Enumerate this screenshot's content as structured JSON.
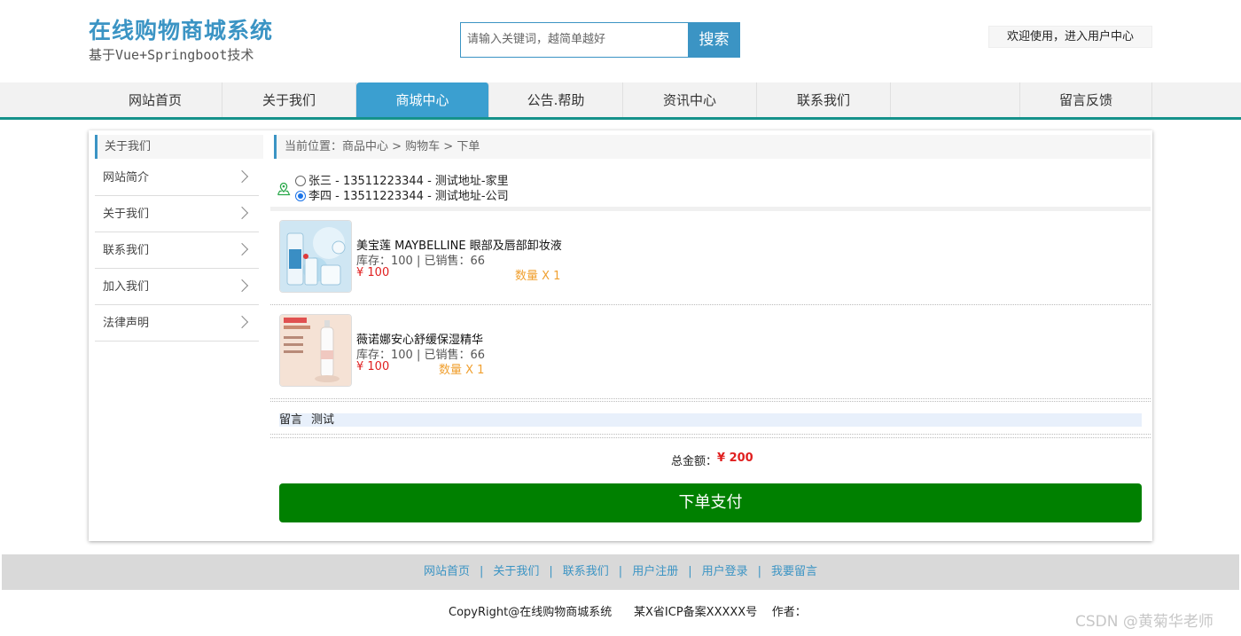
{
  "header": {
    "title": "在线购物商城系统",
    "subtitle": "基于Vue+Springboot技术",
    "search_placeholder": "请输入关键词，越简单越好",
    "search_button": "搜索",
    "welcome": "欢迎使用，进入用户中心"
  },
  "nav": {
    "items": [
      {
        "label": "网站首页"
      },
      {
        "label": "关于我们"
      },
      {
        "label": "商城中心"
      },
      {
        "label": "公告.帮助"
      },
      {
        "label": "资讯中心"
      },
      {
        "label": "联系我们"
      },
      {
        "label": "留言反馈"
      }
    ],
    "active_index": 2
  },
  "sidebar": {
    "heading": "关于我们",
    "items": [
      {
        "label": "网站简介"
      },
      {
        "label": "关于我们"
      },
      {
        "label": "联系我们"
      },
      {
        "label": "加入我们"
      },
      {
        "label": "法律声明"
      }
    ]
  },
  "breadcrumb": "当前位置：商品中心 > 购物车 > 下单",
  "addresses": [
    {
      "text": "张三 - 13511223344 - 测试地址-家里",
      "selected": false
    },
    {
      "text": "李四 - 13511223344 - 测试地址-公司",
      "selected": true
    }
  ],
  "products": [
    {
      "name": "美宝莲 MAYBELLINE 眼部及唇部卸妆液",
      "stock": "库存：100 | 已销售：66",
      "price": "¥ 100",
      "quantity": "数量 X 1"
    },
    {
      "name": "薇诺娜安心舒缓保湿精华",
      "stock": "库存：100 | 已销售：66",
      "price": "¥ 100",
      "quantity": "数量 X 1"
    }
  ],
  "message": {
    "label": "留言",
    "value": "测试"
  },
  "total": {
    "label": "总金额：",
    "value": "¥ 200"
  },
  "pay_button": "下单支付",
  "footer": {
    "links": [
      {
        "label": "网站首页"
      },
      {
        "label": "关于我们"
      },
      {
        "label": "联系我们"
      },
      {
        "label": "用户注册"
      },
      {
        "label": "用户登录"
      },
      {
        "label": "我要留言"
      }
    ],
    "copyright": "CopyRight@在线购物商城系统      某X省ICP备案XXXXX号    作者："
  },
  "watermark": "CSDN @黄菊华老师",
  "colors": {
    "accent": "#3b94c4",
    "nav_active": "#3b9fd0",
    "nav_underline": "#16928b",
    "pay_button": "#008000",
    "price": "#e02020",
    "quantity": "#f0a030"
  }
}
